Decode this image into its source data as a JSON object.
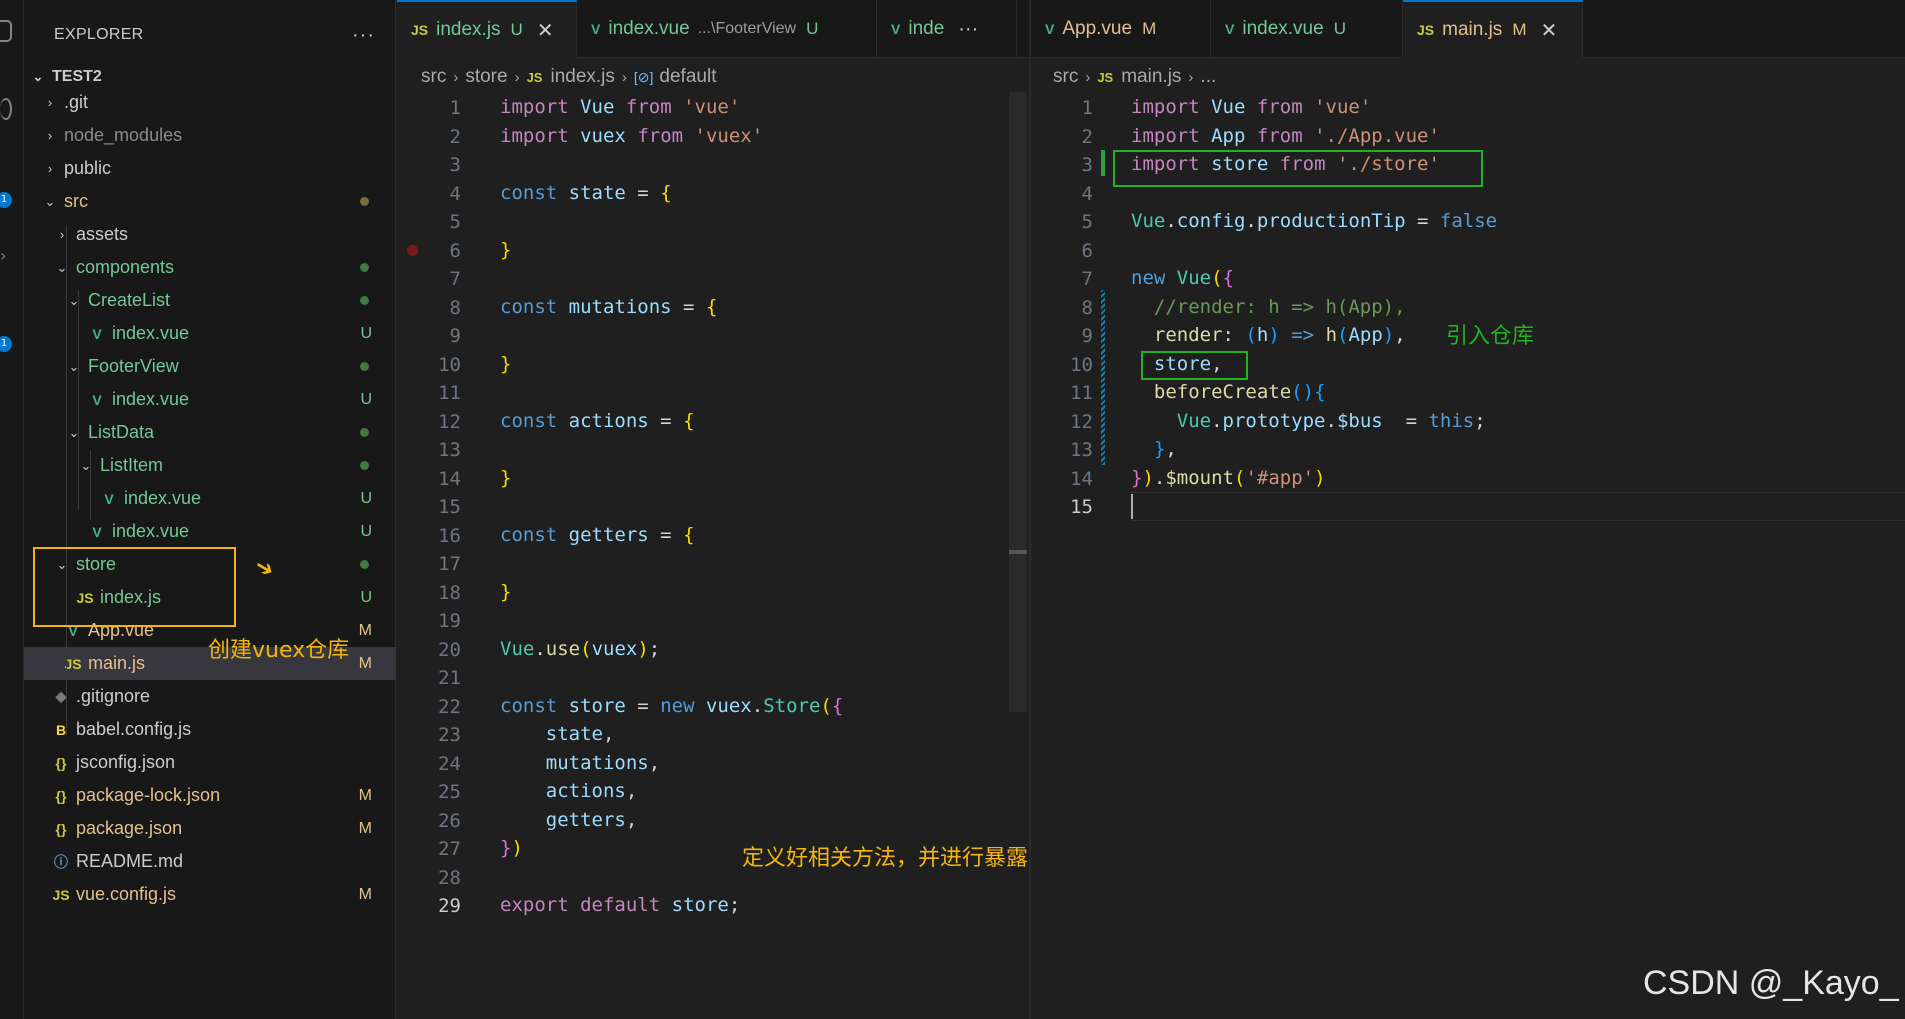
{
  "explorer": {
    "title": "EXPLORER",
    "more": "···",
    "root": "TEST2",
    "items": [
      {
        "name": ".git",
        "chev": "›",
        "icon": "",
        "badge": "",
        "dot": "",
        "color": "#cccccc"
      },
      {
        "name": "node_modules",
        "chev": "›",
        "icon": "",
        "badge": "",
        "dot": "",
        "color": "#8c8c8c"
      },
      {
        "name": "public",
        "chev": "›",
        "icon": "",
        "badge": "",
        "dot": "",
        "color": "#cccccc"
      },
      {
        "name": "src",
        "chev": "⌄",
        "icon": "",
        "badge": "",
        "dot": "#7a6b3d",
        "color": "#e2c08d"
      },
      {
        "name": "assets",
        "chev": "›",
        "icon": "",
        "badge": "",
        "dot": "",
        "color": "#cccccc"
      },
      {
        "name": "components",
        "chev": "⌄",
        "icon": "",
        "badge": "",
        "dot": "#3f7a3f",
        "color": "#73c991"
      },
      {
        "name": "CreateList",
        "chev": "⌄",
        "icon": "",
        "badge": "",
        "dot": "#3f7a3f",
        "color": "#73c991"
      },
      {
        "name": "index.vue",
        "chev": "",
        "icon": "vue",
        "badge": "U",
        "dot": "",
        "color": "#73c991"
      },
      {
        "name": "FooterView",
        "chev": "⌄",
        "icon": "",
        "badge": "",
        "dot": "#3f7a3f",
        "color": "#73c991"
      },
      {
        "name": "index.vue",
        "chev": "",
        "icon": "vue",
        "badge": "U",
        "dot": "",
        "color": "#73c991"
      },
      {
        "name": "ListData",
        "chev": "⌄",
        "icon": "",
        "badge": "",
        "dot": "#3f7a3f",
        "color": "#73c991"
      },
      {
        "name": "ListItem",
        "chev": "⌄",
        "icon": "",
        "badge": "",
        "dot": "#3f7a3f",
        "color": "#73c991"
      },
      {
        "name": "index.vue",
        "chev": "",
        "icon": "vue",
        "badge": "U",
        "dot": "",
        "color": "#73c991"
      },
      {
        "name": "index.vue",
        "chev": "",
        "icon": "vue",
        "badge": "U",
        "dot": "",
        "color": "#73c991"
      },
      {
        "name": "store",
        "chev": "⌄",
        "icon": "",
        "badge": "",
        "dot": "#3f7a3f",
        "color": "#73c991"
      },
      {
        "name": "index.js",
        "chev": "",
        "icon": "js",
        "badge": "U",
        "dot": "",
        "color": "#73c991"
      },
      {
        "name": "App.vue",
        "chev": "",
        "icon": "vue",
        "badge": "M",
        "dot": "",
        "color": "#e2c08d"
      },
      {
        "name": "main.js",
        "chev": "",
        "icon": "js",
        "badge": "M",
        "dot": "",
        "color": "#e2c08d"
      },
      {
        "name": ".gitignore",
        "chev": "",
        "icon": "git",
        "badge": "",
        "dot": "",
        "color": "#cccccc"
      },
      {
        "name": "babel.config.js",
        "chev": "",
        "icon": "babel",
        "badge": "",
        "dot": "",
        "color": "#cccccc"
      },
      {
        "name": "jsconfig.json",
        "chev": "",
        "icon": "json",
        "badge": "",
        "dot": "",
        "color": "#cccccc"
      },
      {
        "name": "package-lock.json",
        "chev": "",
        "icon": "json",
        "badge": "M",
        "dot": "",
        "color": "#e2c08d"
      },
      {
        "name": "package.json",
        "chev": "",
        "icon": "json",
        "badge": "M",
        "dot": "",
        "color": "#e2c08d"
      },
      {
        "name": "README.md",
        "chev": "",
        "icon": "info",
        "badge": "",
        "dot": "",
        "color": "#cccccc"
      },
      {
        "name": "vue.config.js",
        "chev": "",
        "icon": "js",
        "badge": "M",
        "dot": "",
        "color": "#e2c08d"
      }
    ]
  },
  "left_editor": {
    "tabs": [
      {
        "icon": "JS",
        "label": "index.js",
        "desc": "",
        "status": "U",
        "close": "✕"
      },
      {
        "icon": "V",
        "label": "index.vue",
        "desc": "...\\FooterView",
        "status": "U",
        "close": ""
      },
      {
        "icon": "V",
        "label": "inde",
        "desc": "",
        "status": "",
        "close": "···"
      }
    ],
    "breadcrumb": [
      "src",
      "store",
      "index.js",
      "default"
    ],
    "breadcrumb_icons": [
      "JS",
      "[⊘]"
    ],
    "lines": [
      [
        [
          "k",
          "import"
        ],
        [
          "p",
          " "
        ],
        [
          "v",
          "Vue"
        ],
        [
          "p",
          " "
        ],
        [
          "k",
          "from"
        ],
        [
          "p",
          " "
        ],
        [
          "s",
          "'vue'"
        ]
      ],
      [
        [
          "k",
          "import"
        ],
        [
          "p",
          " "
        ],
        [
          "v",
          "vuex"
        ],
        [
          "p",
          " "
        ],
        [
          "k",
          "from"
        ],
        [
          "p",
          " "
        ],
        [
          "s",
          "'vuex'"
        ]
      ],
      [],
      [
        [
          "d",
          "const"
        ],
        [
          "p",
          " "
        ],
        [
          "v",
          "state"
        ],
        [
          "p",
          " = "
        ],
        [
          "y",
          "{"
        ]
      ],
      [],
      [
        [
          "y",
          "}"
        ]
      ],
      [],
      [
        [
          "d",
          "const"
        ],
        [
          "p",
          " "
        ],
        [
          "v",
          "mutations"
        ],
        [
          "p",
          " = "
        ],
        [
          "y",
          "{"
        ]
      ],
      [],
      [
        [
          "y",
          "}"
        ]
      ],
      [],
      [
        [
          "d",
          "const"
        ],
        [
          "p",
          " "
        ],
        [
          "v",
          "actions"
        ],
        [
          "p",
          " = "
        ],
        [
          "y",
          "{"
        ]
      ],
      [],
      [
        [
          "y",
          "}"
        ]
      ],
      [],
      [
        [
          "d",
          "const"
        ],
        [
          "p",
          " "
        ],
        [
          "v",
          "getters"
        ],
        [
          "p",
          " = "
        ],
        [
          "y",
          "{"
        ]
      ],
      [],
      [
        [
          "y",
          "}"
        ]
      ],
      [],
      [
        [
          "t",
          "Vue"
        ],
        [
          "p",
          "."
        ],
        [
          "f",
          "use"
        ],
        [
          "y",
          "("
        ],
        [
          "v",
          "vuex"
        ],
        [
          "y",
          ")"
        ],
        [
          "p",
          ";"
        ]
      ],
      [],
      [
        [
          "d",
          "const"
        ],
        [
          "p",
          " "
        ],
        [
          "v",
          "store"
        ],
        [
          "p",
          " = "
        ],
        [
          "d",
          "new"
        ],
        [
          "p",
          " "
        ],
        [
          "v",
          "vuex"
        ],
        [
          "p",
          "."
        ],
        [
          "t",
          "Store"
        ],
        [
          "y",
          "("
        ],
        [
          "br2",
          "{"
        ]
      ],
      [
        [
          "p",
          "    "
        ],
        [
          "v",
          "state"
        ],
        [
          "p",
          ","
        ]
      ],
      [
        [
          "p",
          "    "
        ],
        [
          "v",
          "mutations"
        ],
        [
          "p",
          ","
        ]
      ],
      [
        [
          "p",
          "    "
        ],
        [
          "v",
          "actions"
        ],
        [
          "p",
          ","
        ]
      ],
      [
        [
          "p",
          "    "
        ],
        [
          "v",
          "getters"
        ],
        [
          "p",
          ","
        ]
      ],
      [
        [
          "br2",
          "}"
        ],
        [
          "y",
          ")"
        ]
      ],
      [],
      [
        [
          "k",
          "export"
        ],
        [
          "p",
          " "
        ],
        [
          "k",
          "default"
        ],
        [
          "p",
          " "
        ],
        [
          "v",
          "store"
        ],
        [
          "p",
          ";"
        ]
      ]
    ],
    "current_line": "29"
  },
  "right_editor": {
    "tabs": [
      {
        "icon": "V",
        "label": "App.vue",
        "desc": "",
        "status": "M",
        "close": ""
      },
      {
        "icon": "V",
        "label": "index.vue",
        "desc": "",
        "status": "U",
        "close": ""
      },
      {
        "icon": "JS",
        "label": "main.js",
        "desc": "",
        "status": "M",
        "close": "✕"
      }
    ],
    "breadcrumb": [
      "src",
      "main.js",
      "..."
    ],
    "breadcrumb_icons": [
      "JS"
    ],
    "lines": [
      [
        [
          "k",
          "import"
        ],
        [
          "p",
          " "
        ],
        [
          "v",
          "Vue"
        ],
        [
          "p",
          " "
        ],
        [
          "k",
          "from"
        ],
        [
          "p",
          " "
        ],
        [
          "s",
          "'vue'"
        ]
      ],
      [
        [
          "k",
          "import"
        ],
        [
          "p",
          " "
        ],
        [
          "v",
          "App"
        ],
        [
          "p",
          " "
        ],
        [
          "k",
          "from"
        ],
        [
          "p",
          " "
        ],
        [
          "s",
          "'./App.vue'"
        ]
      ],
      [
        [
          "k",
          "import"
        ],
        [
          "p",
          " "
        ],
        [
          "v",
          "store"
        ],
        [
          "p",
          " "
        ],
        [
          "k",
          "from"
        ],
        [
          "p",
          " "
        ],
        [
          "s",
          "'./store'"
        ]
      ],
      [],
      [
        [
          "t",
          "Vue"
        ],
        [
          "p",
          "."
        ],
        [
          "v",
          "config"
        ],
        [
          "p",
          "."
        ],
        [
          "v",
          "productionTip"
        ],
        [
          "p",
          " = "
        ],
        [
          "d",
          "false"
        ]
      ],
      [],
      [
        [
          "d",
          "new"
        ],
        [
          "p",
          " "
        ],
        [
          "t",
          "Vue"
        ],
        [
          "y",
          "("
        ],
        [
          "br2",
          "{"
        ]
      ],
      [
        [
          "p",
          "  "
        ],
        [
          "c",
          "//render: h => h(App),"
        ]
      ],
      [
        [
          "p",
          "  "
        ],
        [
          "f",
          "render"
        ],
        [
          "p",
          ": "
        ],
        [
          "br3",
          "("
        ],
        [
          "v",
          "h"
        ],
        [
          "br3",
          ")"
        ],
        [
          "p",
          " "
        ],
        [
          "d",
          "=>"
        ],
        [
          "p",
          " "
        ],
        [
          "f",
          "h"
        ],
        [
          "br3",
          "("
        ],
        [
          "v",
          "App"
        ],
        [
          "br3",
          ")"
        ],
        [
          "p",
          ","
        ]
      ],
      [
        [
          "p",
          "  "
        ],
        [
          "v",
          "store"
        ],
        [
          "p",
          ","
        ]
      ],
      [
        [
          "p",
          "  "
        ],
        [
          "f",
          "beforeCreate"
        ],
        [
          "br3",
          "()"
        ],
        [
          "br3",
          "{"
        ]
      ],
      [
        [
          "p",
          "    "
        ],
        [
          "t",
          "Vue"
        ],
        [
          "p",
          "."
        ],
        [
          "v",
          "prototype"
        ],
        [
          "p",
          "."
        ],
        [
          "v",
          "$bus"
        ],
        [
          "p",
          "  = "
        ],
        [
          "d",
          "this"
        ],
        [
          "p",
          ";"
        ]
      ],
      [
        [
          "p",
          "  "
        ],
        [
          "br3",
          "}"
        ],
        [
          "p",
          ","
        ]
      ],
      [
        [
          "br2",
          "}"
        ],
        [
          "y",
          ")"
        ],
        [
          "p",
          "."
        ],
        [
          "f",
          "$mount"
        ],
        [
          "y",
          "("
        ],
        [
          "s",
          "'#app'"
        ],
        [
          "y",
          ")"
        ]
      ],
      []
    ],
    "current_line": "15"
  },
  "annotations": {
    "create_store": "创建vuex仓库",
    "define_methods": "定义好相关方法，并进行暴露",
    "import_store": "引入仓库",
    "watermark": "CSDN @_Kayo_"
  },
  "colors": {
    "accent_yellow": "#f5b50e",
    "accent_green": "#22b322",
    "vue_green": "#41b883",
    "js_yellow": "#cbcb41"
  }
}
